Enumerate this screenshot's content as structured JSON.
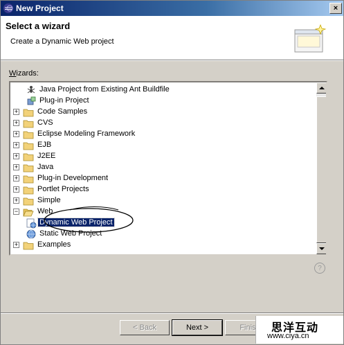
{
  "window": {
    "title": "New Project",
    "close_glyph": "×"
  },
  "banner": {
    "title": "Select a wizard",
    "description": "Create a Dynamic Web project",
    "icon": "wizard-banner-icon"
  },
  "wizards_label": {
    "accel": "W",
    "rest": "izards:"
  },
  "tree": {
    "rows": [
      {
        "label": "Java Project from Existing Ant Buildfile",
        "icon": "ant-icon",
        "toggle": "",
        "depth": 1
      },
      {
        "label": "Plug-in Project",
        "icon": "plugin-icon",
        "toggle": "",
        "depth": 1
      },
      {
        "label": "Code Samples",
        "icon": "folder-icon",
        "toggle": "+",
        "depth": 0
      },
      {
        "label": "CVS",
        "icon": "folder-icon",
        "toggle": "+",
        "depth": 0
      },
      {
        "label": "Eclipse Modeling Framework",
        "icon": "folder-icon",
        "toggle": "+",
        "depth": 0
      },
      {
        "label": "EJB",
        "icon": "folder-icon",
        "toggle": "+",
        "depth": 0
      },
      {
        "label": "J2EE",
        "icon": "folder-icon",
        "toggle": "+",
        "depth": 0
      },
      {
        "label": "Java",
        "icon": "folder-icon",
        "toggle": "+",
        "depth": 0
      },
      {
        "label": "Plug-in Development",
        "icon": "folder-icon",
        "toggle": "+",
        "depth": 0
      },
      {
        "label": "Portlet Projects",
        "icon": "folder-icon",
        "toggle": "+",
        "depth": 0
      },
      {
        "label": "Simple",
        "icon": "folder-icon",
        "toggle": "+",
        "depth": 0
      },
      {
        "label": "Web",
        "icon": "folder-open-icon",
        "toggle": "−",
        "depth": 0
      },
      {
        "label": "Dynamic Web Project",
        "icon": "web-project-icon",
        "toggle": "",
        "depth": 1,
        "selected": true
      },
      {
        "label": "Static Web Project",
        "icon": "globe-icon",
        "toggle": "",
        "depth": 1
      },
      {
        "label": "Examples",
        "icon": "folder-icon",
        "toggle": "+",
        "depth": 0
      }
    ]
  },
  "help_glyph": "?",
  "buttons": {
    "back": "< Back",
    "next": "Next >",
    "finish": "Finish"
  },
  "watermark": {
    "chinese": "思洋互动",
    "url": "www.ciya.cn"
  },
  "colors": {
    "title_bar": "#0a246a",
    "selection": "#0a246a",
    "face": "#d4d0c8",
    "folder": "#f2d27a"
  }
}
